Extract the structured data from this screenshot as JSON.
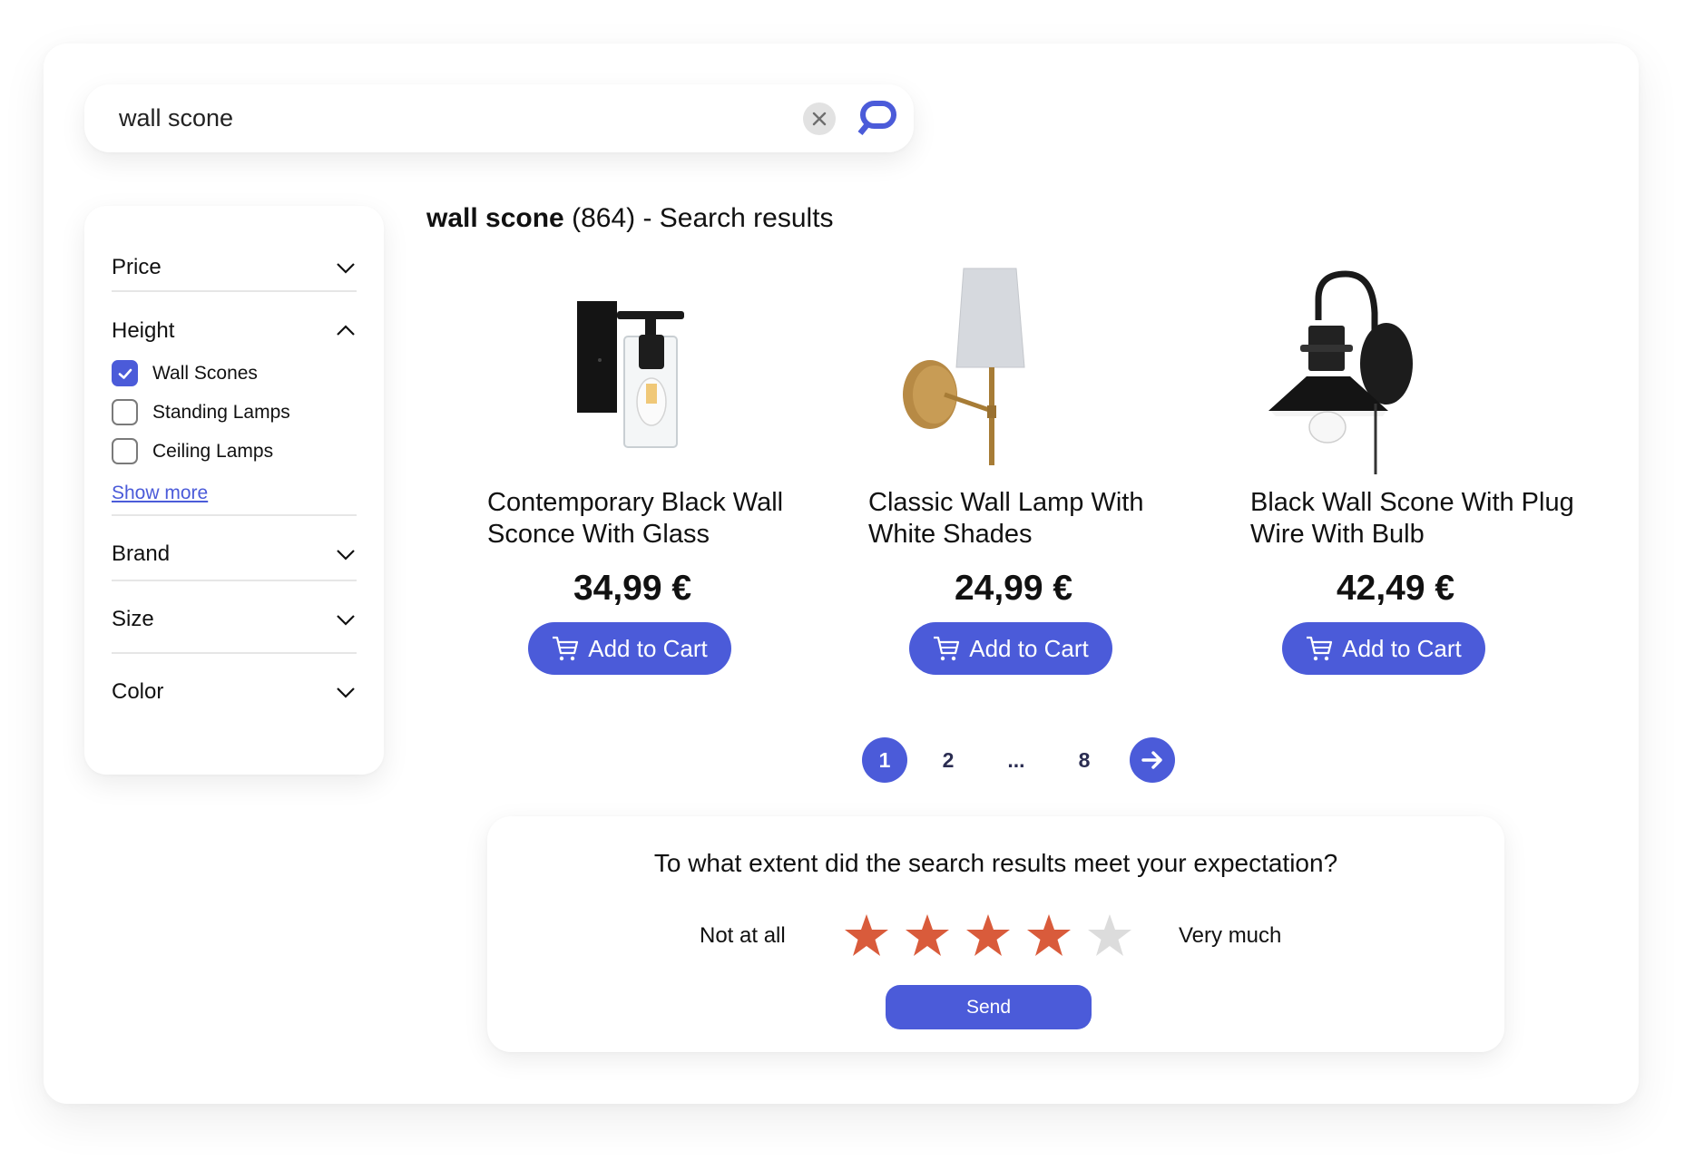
{
  "search": {
    "query": "wall scone",
    "clear_icon": "close-icon",
    "submit_icon": "search-chat-icon"
  },
  "filters": {
    "facets": [
      {
        "label": "Price",
        "expanded": false,
        "icon": "chevron-down-icon"
      },
      {
        "label": "Height",
        "expanded": true,
        "icon": "chevron-up-icon",
        "options": [
          {
            "label": "Wall Scones",
            "checked": true
          },
          {
            "label": "Standing Lamps",
            "checked": false
          },
          {
            "label": "Ceiling Lamps",
            "checked": false
          }
        ],
        "show_more": "Show more"
      },
      {
        "label": "Brand",
        "expanded": false,
        "icon": "chevron-down-icon"
      },
      {
        "label": "Size",
        "expanded": false,
        "icon": "chevron-down-icon"
      },
      {
        "label": "Color",
        "expanded": false,
        "icon": "chevron-down-icon"
      }
    ]
  },
  "results": {
    "query": "wall scone",
    "count": "(864)",
    "suffix": " - Search results"
  },
  "products": [
    {
      "title": "Contemporary Black Wall Sconce With Glass",
      "price": "34,99 €",
      "button": "Add to Cart",
      "image": "black-glass-wall-sconce"
    },
    {
      "title": "Classic Wall Lamp With White Shades",
      "price": "24,99 €",
      "button": "Add to Cart",
      "image": "brass-wall-lamp-white-shade"
    },
    {
      "title": "Black Wall Scone With Plug Wire With Bulb",
      "price": "42,49 €",
      "button": "Add to Cart",
      "image": "black-plug-in-wall-sconce"
    }
  ],
  "pagination": {
    "pages": [
      "1",
      "2",
      "...",
      "8"
    ],
    "current": "1",
    "next_icon": "arrow-right-icon"
  },
  "survey": {
    "question": "To what extent did the search results meet your expectation?",
    "low_label": "Not at all",
    "high_label": "Very much",
    "rating": 4,
    "max_rating": 5,
    "send_label": "Send"
  },
  "colors": {
    "accent": "#4b5bd9",
    "star_filled": "#d95b3b",
    "star_empty": "#dcdcdc",
    "pager_text": "#2b2d52"
  }
}
